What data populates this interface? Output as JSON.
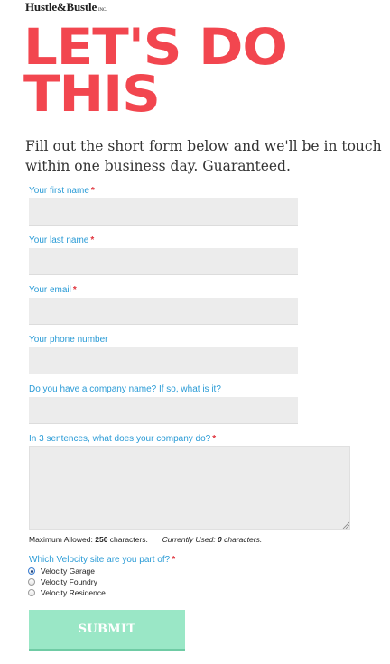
{
  "brand": {
    "name": "Hustle&Bustle",
    "suffix": "INC."
  },
  "headline": {
    "line1": "LET'S DO",
    "line2": "THIS"
  },
  "intro": "Fill out the short form below and we'll be in touch within one business day. Guaranteed.",
  "form": {
    "required_marker": "*",
    "first_name": {
      "label": "Your first name",
      "value": "",
      "required": true
    },
    "last_name": {
      "label": "Your last name",
      "value": "",
      "required": true
    },
    "email": {
      "label": "Your email",
      "value": "",
      "required": true
    },
    "phone": {
      "label": "Your phone number",
      "value": "",
      "required": false
    },
    "company": {
      "label": "Do you have a company name? If so, what is it?",
      "value": "",
      "required": false
    },
    "description": {
      "label": "In 3 sentences, what does your company do?",
      "value": "",
      "required": true
    },
    "counter": {
      "max_label": "Maximum Allowed:",
      "max_value": "250",
      "max_unit": "characters.",
      "used_label": "Currently Used:",
      "used_value": "0",
      "used_unit": "characters."
    },
    "site": {
      "label": "Which Velocity site are you part of?",
      "required": true,
      "options": [
        {
          "label": "Velocity Garage",
          "checked": true
        },
        {
          "label": "Velocity Foundry",
          "checked": false
        },
        {
          "label": "Velocity Residence",
          "checked": false
        }
      ]
    },
    "submit_label": "SUBMIT"
  },
  "colors": {
    "headline": "#f2464f",
    "label": "#2a9bd6",
    "required": "#e0363f",
    "input_bg": "#ececec",
    "submit_bg": "#9ae7c6"
  }
}
